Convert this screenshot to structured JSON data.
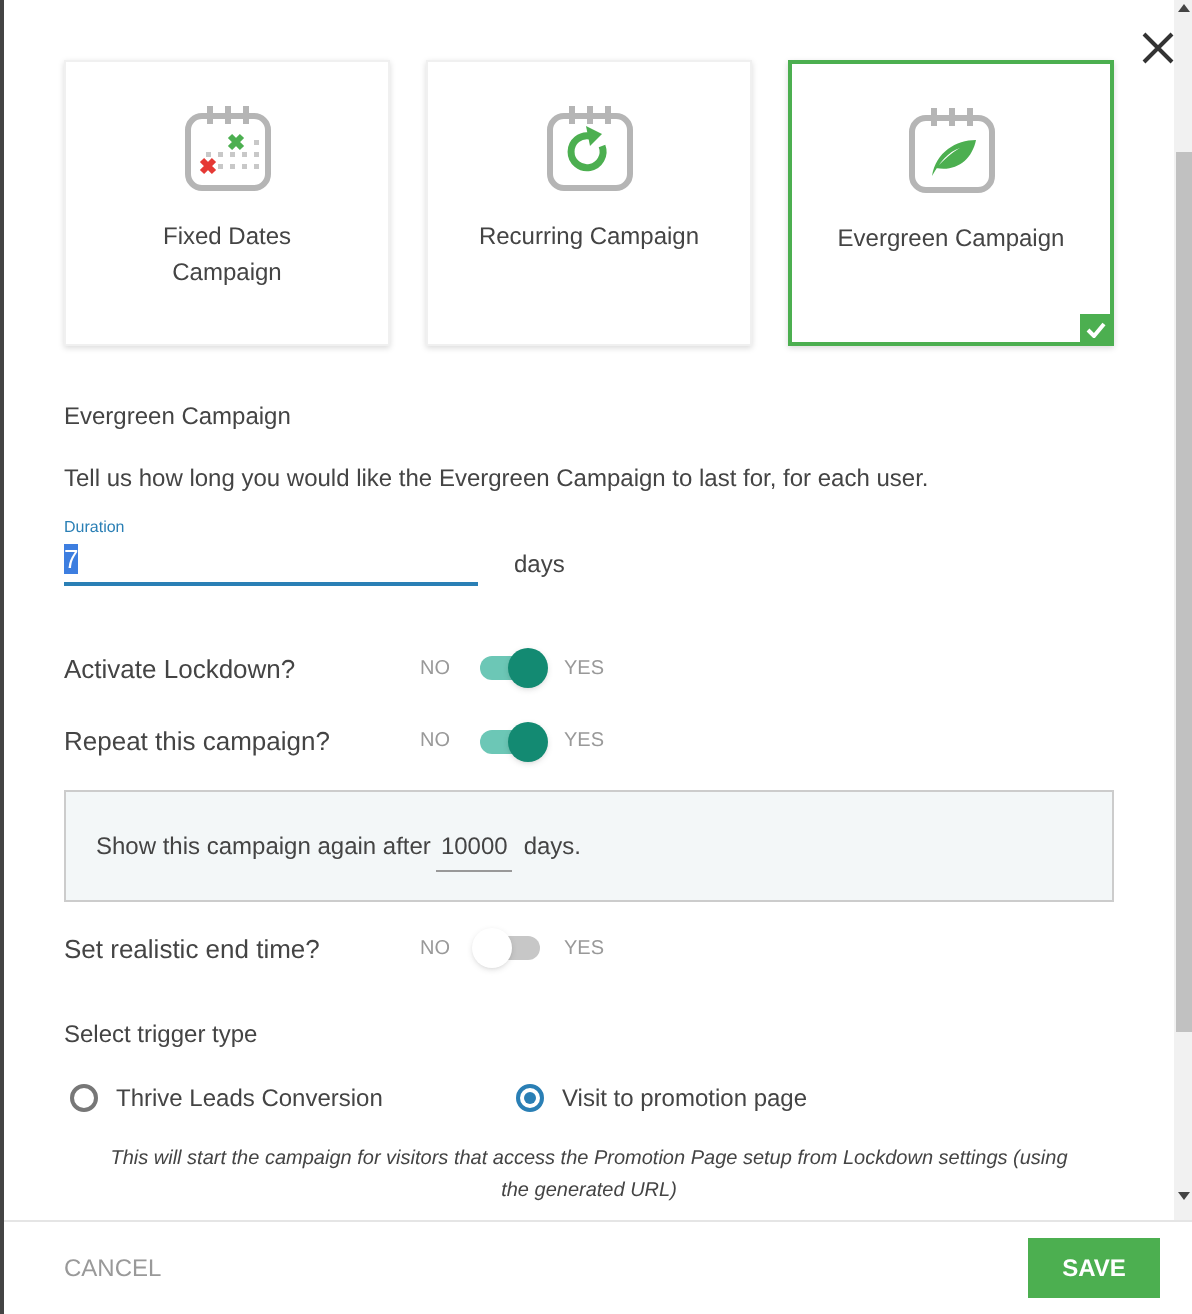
{
  "campaign_types": [
    {
      "kind": "fixed",
      "label": "Fixed Dates Campaign",
      "selected": false
    },
    {
      "kind": "recurring",
      "label": "Recurring Campaign",
      "selected": false
    },
    {
      "kind": "evergreen",
      "label": "Evergreen Campaign",
      "selected": true
    }
  ],
  "section_title": "Evergreen Campaign",
  "description": "Tell us how long you would like the Evergreen Campaign to last for, for each user.",
  "duration": {
    "label": "Duration",
    "value": "7",
    "unit": "days"
  },
  "toggles": [
    {
      "label": "Activate Lockdown?",
      "off_label": "NO",
      "on_label": "YES",
      "on": true
    },
    {
      "label": "Repeat this campaign?",
      "off_label": "NO",
      "on_label": "YES",
      "on": true
    }
  ],
  "repeat_box": {
    "prefix": "Show this campaign again after",
    "value": "10000",
    "suffix": "days."
  },
  "end_time_toggle": {
    "label": "Set realistic end time?",
    "off_label": "NO",
    "on_label": "YES",
    "on": false
  },
  "trigger": {
    "title": "Select trigger type",
    "options": [
      {
        "label": "Thrive Leads Conversion",
        "selected": false
      },
      {
        "label": "Visit to promotion page",
        "selected": true
      }
    ],
    "note": "This will start the campaign for visitors that access the Promotion Page setup from Lockdown settings (using the generated URL)"
  },
  "footer": {
    "cancel": "CANCEL",
    "save": "SAVE"
  }
}
